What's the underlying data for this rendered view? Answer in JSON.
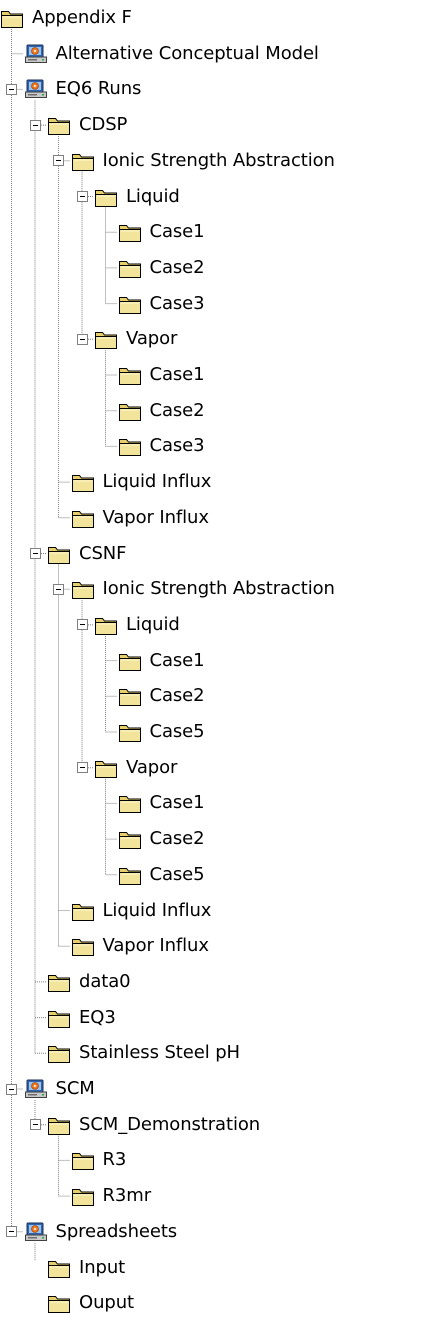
{
  "tree": {
    "label": "Appendix F",
    "icon": "folder-icon",
    "children": [
      {
        "label": "Alternative Conceptual Model",
        "icon": "cd-drive-icon"
      },
      {
        "label": "EQ6 Runs",
        "icon": "cd-drive-icon",
        "expanded": true,
        "children": [
          {
            "label": "CDSP",
            "icon": "folder-icon",
            "expanded": true,
            "children": [
              {
                "label": "Ionic Strength Abstraction",
                "icon": "folder-icon",
                "expanded": true,
                "children": [
                  {
                    "label": "Liquid",
                    "icon": "folder-icon",
                    "expanded": true,
                    "children": [
                      {
                        "label": "Case1",
                        "icon": "folder-icon"
                      },
                      {
                        "label": "Case2",
                        "icon": "folder-icon"
                      },
                      {
                        "label": "Case3",
                        "icon": "folder-icon"
                      }
                    ]
                  },
                  {
                    "label": "Vapor",
                    "icon": "folder-icon",
                    "expanded": true,
                    "children": [
                      {
                        "label": "Case1",
                        "icon": "folder-icon"
                      },
                      {
                        "label": "Case2",
                        "icon": "folder-icon"
                      },
                      {
                        "label": "Case3",
                        "icon": "folder-icon"
                      }
                    ]
                  }
                ]
              },
              {
                "label": "Liquid Influx",
                "icon": "folder-icon"
              },
              {
                "label": "Vapor Influx",
                "icon": "folder-icon"
              }
            ]
          },
          {
            "label": "CSNF",
            "icon": "folder-icon",
            "expanded": true,
            "children": [
              {
                "label": "Ionic Strength Abstraction",
                "icon": "folder-icon",
                "expanded": true,
                "children": [
                  {
                    "label": "Liquid",
                    "icon": "folder-icon",
                    "expanded": true,
                    "children": [
                      {
                        "label": "Case1",
                        "icon": "folder-icon"
                      },
                      {
                        "label": "Case2",
                        "icon": "folder-icon"
                      },
                      {
                        "label": "Case5",
                        "icon": "folder-icon"
                      }
                    ]
                  },
                  {
                    "label": "Vapor",
                    "icon": "folder-icon",
                    "expanded": true,
                    "children": [
                      {
                        "label": "Case1",
                        "icon": "folder-icon"
                      },
                      {
                        "label": "Case2",
                        "icon": "folder-icon"
                      },
                      {
                        "label": "Case5",
                        "icon": "folder-icon"
                      }
                    ]
                  }
                ]
              },
              {
                "label": "Liquid Influx",
                "icon": "folder-icon"
              },
              {
                "label": "Vapor Influx",
                "icon": "folder-icon"
              }
            ]
          },
          {
            "label": "data0",
            "icon": "folder-icon"
          },
          {
            "label": "EQ3",
            "icon": "folder-icon"
          },
          {
            "label": "Stainless Steel pH",
            "icon": "folder-icon"
          }
        ]
      },
      {
        "label": "SCM",
        "icon": "cd-drive-icon",
        "expanded": true,
        "children": [
          {
            "label": "SCM_Demonstration",
            "icon": "folder-icon",
            "expanded": true,
            "children": [
              {
                "label": "R3",
                "icon": "folder-icon"
              },
              {
                "label": "R3mr",
                "icon": "folder-icon"
              }
            ]
          }
        ]
      },
      {
        "label": "Spreadsheets",
        "icon": "cd-drive-icon",
        "expanded": true,
        "children": [
          {
            "label": "Input",
            "icon": "folder-icon"
          },
          {
            "label": "Ouput",
            "icon": "folder-icon"
          }
        ]
      }
    ]
  },
  "colors": {
    "folder_body": "#f2e49a",
    "folder_shade": "#e6cf6a",
    "folder_outline": "#000000",
    "tree_line": "#808080",
    "expander_border": "#808080"
  }
}
